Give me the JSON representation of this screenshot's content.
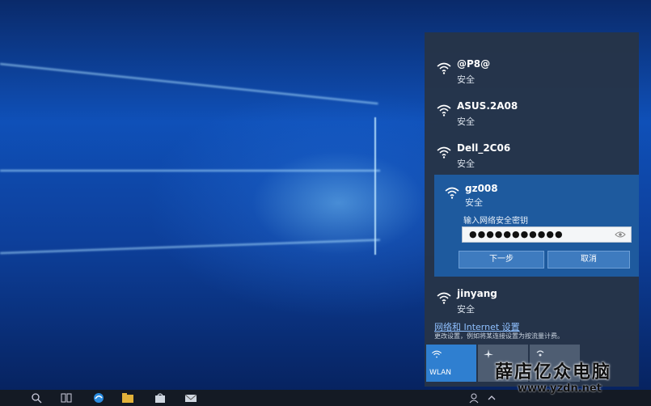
{
  "networks": [
    {
      "name": "@P8@",
      "security": "安全"
    },
    {
      "name": "ASUS.2A08",
      "security": "安全"
    },
    {
      "name": "Dell_2C06",
      "security": "安全"
    }
  ],
  "selected_network": {
    "name": "gz008",
    "security": "安全",
    "password_prompt": "输入网络安全密钥",
    "password_value": "●●●●●●●●●●●",
    "next_label": "下一步",
    "cancel_label": "取消"
  },
  "other_network": {
    "name": "jinyang",
    "security": "安全"
  },
  "settings": {
    "link": "网络和 Internet 设置",
    "description": "更改设置，例如将某连接设置为按流量计费。"
  },
  "quick_actions": {
    "wlan_label": "WLAN"
  },
  "watermark": {
    "text": "薛店亿众电脑",
    "url": "www.yzdn.net"
  },
  "colors": {
    "panel": "#263448",
    "selected": "#1e5a9e",
    "accent": "#2f7fd0"
  }
}
